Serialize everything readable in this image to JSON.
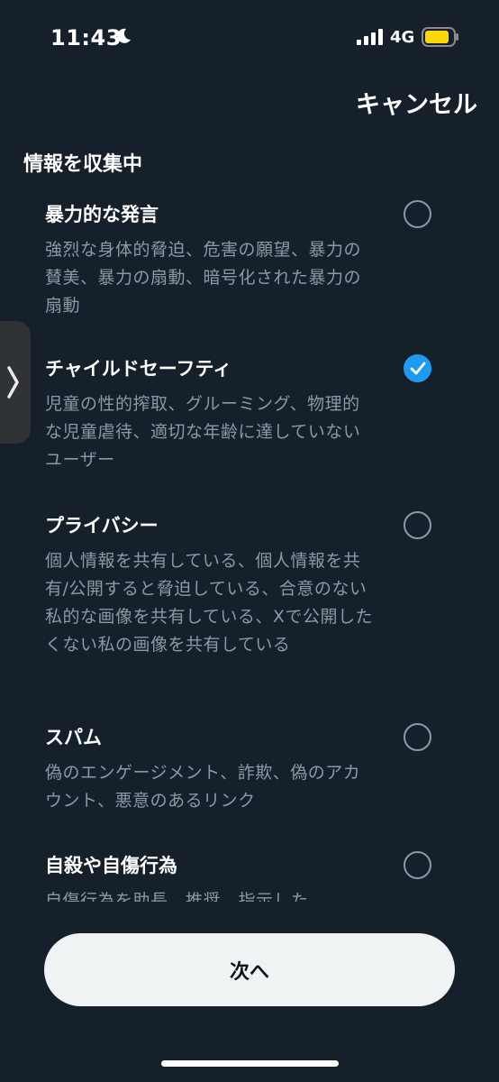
{
  "status_bar": {
    "time": "11:43",
    "network": "4G",
    "battery_color": "#ffd60a"
  },
  "header": {
    "cancel_label": "キャンセル"
  },
  "section": {
    "title": "情報を収集中"
  },
  "options": [
    {
      "title": "暴力的な発言",
      "description": "強烈な身体的脅迫、危害の願望、暴力の賛美、暴力の扇動、暗号化された暴力の扇動",
      "selected": false
    },
    {
      "title": "チャイルドセーフティ",
      "description": "児童の性的搾取、グルーミング、物理的な児童虐待、適切な年齢に達していないユーザー",
      "selected": true
    },
    {
      "title": "プライバシー",
      "description": "個人情報を共有している、個人情報を共有/公開すると脅迫している、合意のない私的な画像を共有している、Xで公開したくない私の画像を共有している",
      "selected": false
    },
    {
      "title": "スパム",
      "description": "偽のエンゲージメント、詐欺、偽のアカウント、悪意のあるリンク",
      "selected": false
    },
    {
      "title": "自殺や自傷行為",
      "description": "自傷行為を助長、推奨、指示した",
      "selected": false
    }
  ],
  "footer": {
    "next_label": "次へ"
  },
  "colors": {
    "background": "#15202b",
    "accent": "#1d9bf0",
    "secondary_text": "#8b98a5"
  }
}
